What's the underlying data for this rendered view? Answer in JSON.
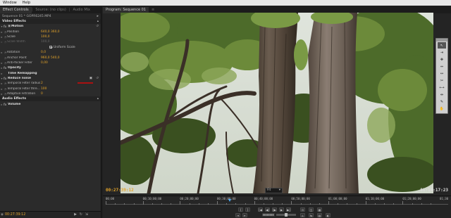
{
  "menubar": {
    "items": [
      "Window",
      "Help"
    ]
  },
  "left_panel": {
    "tabs": [
      "Effect Controls",
      "Source: (no clips)",
      "Audio Mix"
    ],
    "sequence_label": "Sequence 01 * GOPR6245.MP4",
    "video_effects": {
      "title": "Video Effects",
      "motion": {
        "label": "Motion",
        "position": {
          "label": "Position",
          "x": "640,0",
          "y": "360,0"
        },
        "scale": {
          "label": "Scale",
          "value": "100,0"
        },
        "scale_width": {
          "label": "Scale Width",
          "value": "100,0"
        },
        "uniform_scale": "Uniform Scale",
        "rotation": {
          "label": "Rotation",
          "value": "0,0"
        },
        "anchor_point": {
          "label": "Anchor Point",
          "x": "960,0",
          "y": "540,0"
        },
        "anti_flicker": {
          "label": "Anti-flicker Filter",
          "value": "0,00"
        }
      },
      "opacity": "Opacity",
      "time_remapping": "Time Remapping",
      "reduce_noise": {
        "label": "Reduce noise",
        "temporal_radius": {
          "label": "Temporal Filter radius",
          "value": "2"
        },
        "temporal_threshold": {
          "label": "Temporal Filter thre...",
          "value": "100"
        },
        "adaptive": {
          "label": "Adaptive Filtration",
          "value": "0"
        }
      }
    },
    "audio_effects": {
      "title": "Audio Effects",
      "volume": "Volume"
    },
    "timecode": "00:27:39:12"
  },
  "program": {
    "tabs": [
      "Program: Sequence 01"
    ],
    "timecode_current": "00:27:39:12",
    "timecode_duration": "01:14:17:23",
    "fit": "Fit",
    "ruler_ticks": [
      "00;00",
      "00;10;00;00",
      "00;20;00;00",
      "00;30;00;00",
      "00;40;00;00",
      "00;50;00;00",
      "01;00;00;00",
      "01;10;00;00",
      "01;20;00;00",
      "01;30"
    ],
    "playhead_fraction": 0.372
  },
  "tools": [
    "selection-tool",
    "track-select-tool",
    "ripple-edit-tool",
    "rolling-edit-tool",
    "rate-stretch-tool",
    "razor-tool",
    "slip-tool",
    "slide-tool",
    "pen-tool",
    "hand-tool",
    "zoom-tool"
  ],
  "tool_glyphs": [
    "↖",
    "⇥",
    "✥",
    "⇔",
    "↔",
    "✂",
    "⟷",
    "⇹",
    "✎",
    "✋",
    "🔍"
  ],
  "transport": {
    "row1": [
      "{",
      "}",
      "|◀",
      "◀|",
      "|▶",
      "▶",
      "▶|",
      "⊡",
      "◫",
      "▦"
    ],
    "row2": [
      "⇥",
      "⇤",
      "⌂",
      "⇆",
      "▤",
      "◐"
    ]
  },
  "colors": {
    "accent": "#e5a52a",
    "panel": "#2b2b2b",
    "playhead": "#4ab0ff"
  }
}
